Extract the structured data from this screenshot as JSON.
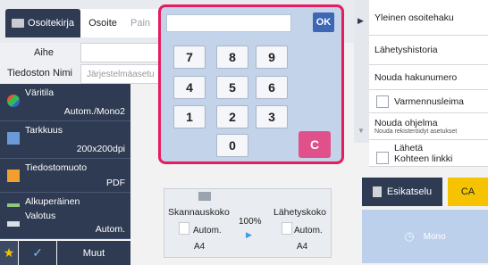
{
  "tabs": {
    "address_book": "Osoitekirja",
    "address": "Osoite",
    "print": "Pain"
  },
  "fields": {
    "subject_label": "Aihe",
    "filename_label": "Tiedoston Nimi",
    "filename_value": "Järjestelmäasetu"
  },
  "left_menu": [
    {
      "title": "Väritila",
      "value": "Autom./Mono2"
    },
    {
      "title": "Tarkkuus",
      "value": "200x200dpi"
    },
    {
      "title": "Tiedostomuoto",
      "value": "PDF"
    },
    {
      "title": "Alkuperäinen",
      "value": ""
    },
    {
      "title": "Valotus",
      "value": "Autom."
    }
  ],
  "bottom_left": {
    "other_label": "Muut"
  },
  "keypad": {
    "ok": "OK",
    "keys": [
      "7",
      "8",
      "9",
      "4",
      "5",
      "6",
      "1",
      "2",
      "3",
      "0"
    ],
    "clear": "C"
  },
  "right_menu": {
    "general_search": "Yleinen osoitehaku",
    "history": "Lähetyshistoria",
    "fetch_number": "Nouda hakunumero",
    "verification_stamp": "Varmennusleima",
    "fetch_program": "Nouda ohjelma",
    "fetch_program_sub": "Nouda rekisteröidyt asetukset",
    "send_link_1": "Lähetä",
    "send_link_2": "Kohteen linkki"
  },
  "scan": {
    "scan_size_label": "Skannauskoko",
    "send_size_label": "Lähetyskoko",
    "ratio": "100%",
    "scan_auto": "Autom.",
    "send_auto": "Autom.",
    "scan_paper": "A4",
    "send_paper": "A4"
  },
  "actions": {
    "preview": "Esikatselu",
    "ca": "CA",
    "start": "Mono"
  },
  "colors": {
    "dark_panel": "#2f3b53",
    "highlight": "#e61c5e",
    "ok_button": "#3d66b5",
    "clear_button": "#e0508a",
    "ca_button": "#f5c300"
  }
}
